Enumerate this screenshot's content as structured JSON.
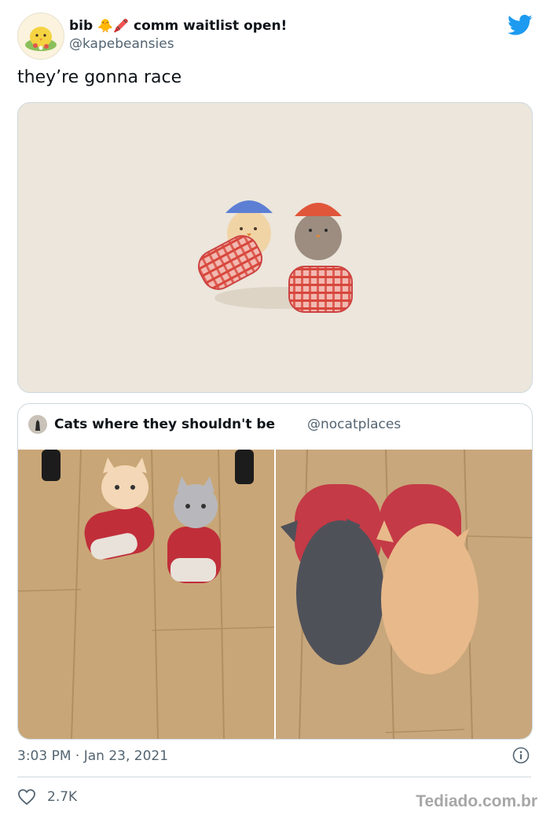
{
  "author": {
    "display_name_start": "bib",
    "display_name_emojis": "🐥🖍️",
    "display_name_end": "comm waitlist open!",
    "handle": "@kapebeansies"
  },
  "tweet": {
    "text": "they’re gonna race"
  },
  "quoted_tweet": {
    "author_name": "Cats where they shouldn't be",
    "author_handle": "@nocatplaces"
  },
  "footer": {
    "timestamp": "3:03 PM · Jan 23, 2021",
    "likes": "2.7K"
  },
  "watermark": "Tediado.com.br",
  "colors": {
    "twitter_blue": "#1d9bf0",
    "secondary_text": "#536471",
    "border": "#cfd9de",
    "illustration_bg": "#ece6dc"
  },
  "icons": [
    "twitter-bird-icon",
    "info-icon",
    "heart-icon"
  ]
}
